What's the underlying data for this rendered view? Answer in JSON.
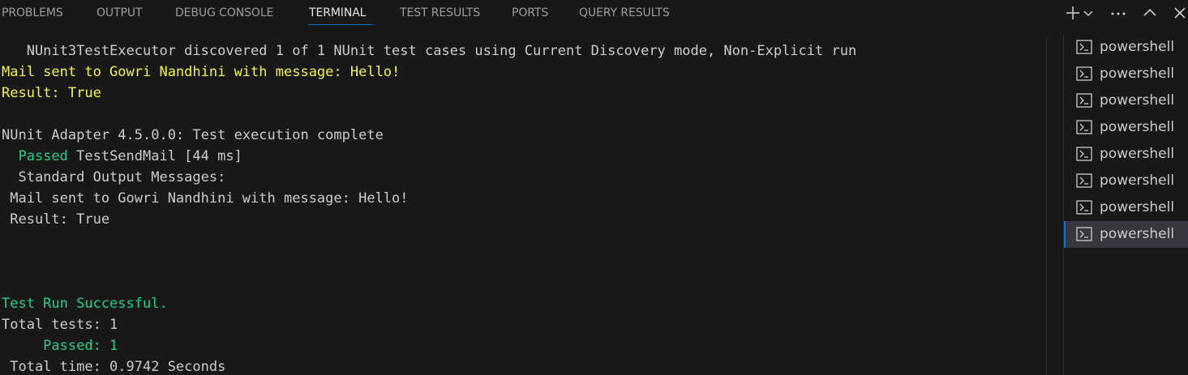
{
  "tabs": [
    {
      "label": "PROBLEMS"
    },
    {
      "label": "OUTPUT"
    },
    {
      "label": "DEBUG CONSOLE"
    },
    {
      "label": "TERMINAL",
      "active": true
    },
    {
      "label": "TEST RESULTS"
    },
    {
      "label": "PORTS"
    },
    {
      "label": "QUERY RESULTS"
    }
  ],
  "toolbar": {
    "icons": [
      "add-icon",
      "chevron-down-icon",
      "more-icon",
      "maximize-icon",
      "close-icon"
    ]
  },
  "terminal": {
    "lines": [
      {
        "text": "   NUnit3TestExecutor discovered 1 of 1 NUnit test cases using Current Discovery mode, Non-Explicit run",
        "color": "#cccccc"
      },
      {
        "text": "Mail sent to Gowri Nandhini with message: Hello!",
        "color": "#f5f543"
      },
      {
        "text": "Result: True",
        "color": "#f5f543"
      },
      {
        "text": "",
        "color": "#cccccc"
      },
      {
        "text": "NUnit Adapter 4.5.0.0: Test execution complete",
        "color": "#cccccc"
      },
      {
        "segments": [
          {
            "text": "  Passed",
            "color": "#23d18b"
          },
          {
            "text": " TestSendMail [44 ms]",
            "color": "#cccccc"
          }
        ]
      },
      {
        "text": "  Standard Output Messages:",
        "color": "#cccccc"
      },
      {
        "text": " Mail sent to Gowri Nandhini with message: Hello!",
        "color": "#cccccc"
      },
      {
        "text": " Result: True",
        "color": "#cccccc"
      },
      {
        "text": "",
        "color": "#cccccc"
      },
      {
        "text": "",
        "color": "#cccccc"
      },
      {
        "text": "",
        "color": "#cccccc"
      },
      {
        "text": "Test Run Successful.",
        "color": "#23d18b"
      },
      {
        "text": "Total tests: 1",
        "color": "#cccccc"
      },
      {
        "text": "     Passed: 1",
        "color": "#23d18b"
      },
      {
        "text": " Total time: 0.9742 Seconds",
        "color": "#cccccc"
      }
    ]
  },
  "terminal_list": {
    "items": [
      {
        "label": "powershell",
        "icon": "terminal-powershell-icon"
      },
      {
        "label": "powershell",
        "icon": "terminal-powershell-icon"
      },
      {
        "label": "powershell",
        "icon": "terminal-powershell-icon"
      },
      {
        "label": "powershell",
        "icon": "terminal-powershell-icon"
      },
      {
        "label": "powershell",
        "icon": "terminal-powershell-icon"
      },
      {
        "label": "powershell",
        "icon": "terminal-powershell-icon"
      },
      {
        "label": "powershell",
        "icon": "terminal-powershell-icon"
      },
      {
        "label": "powershell",
        "icon": "terminal-powershell-icon",
        "selected": true
      }
    ]
  },
  "colors": {
    "background": "#181818",
    "text": "#cccccc",
    "yellow": "#f5f543",
    "green": "#23d18b",
    "accent": "#0078d4",
    "selected_bg": "#37373d"
  }
}
